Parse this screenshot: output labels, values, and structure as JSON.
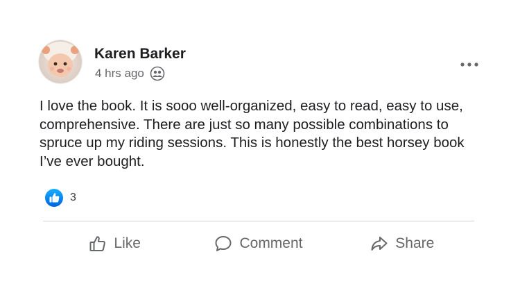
{
  "post": {
    "author": "Karen Barker",
    "timestamp": "4 hrs ago",
    "audience_icon": "friends-icon",
    "text": "I love the book. It is sooo well-organized, easy to read, easy to use, comprehensive. There are just so many possible combinations to spruce up my riding sessions. This is honestly the best horsey book I’ve ever bought.",
    "reactions": {
      "icon": "like-reaction-icon",
      "count": "3"
    }
  },
  "actions": {
    "like": "Like",
    "comment": "Comment",
    "share": "Share"
  },
  "colors": {
    "brand_blue": "#1877f2",
    "secondary_text": "#65676b"
  }
}
